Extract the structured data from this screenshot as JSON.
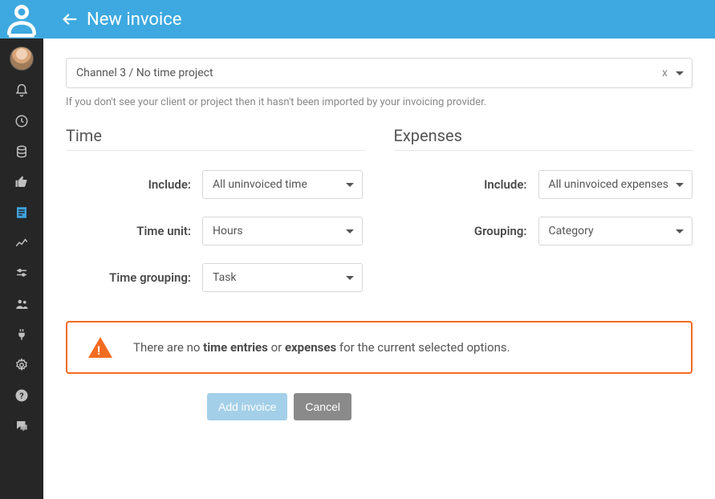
{
  "header": {
    "title": "New invoice"
  },
  "project_select": {
    "value": "Channel 3 / No time project",
    "clear": "x"
  },
  "help_text": "If you don't see your client or project then it hasn't been imported by your invoicing provider.",
  "time_section": {
    "title": "Time",
    "rows": {
      "include": {
        "label": "Include:",
        "value": "All uninvoiced time"
      },
      "time_unit": {
        "label": "Time unit:",
        "value": "Hours"
      },
      "time_grouping": {
        "label": "Time grouping:",
        "value": "Task"
      }
    }
  },
  "expenses_section": {
    "title": "Expenses",
    "rows": {
      "include": {
        "label": "Include:",
        "value": "All uninvoiced expenses"
      },
      "grouping": {
        "label": "Grouping:",
        "value": "Category"
      }
    }
  },
  "alert": {
    "prefix": "There are no ",
    "b1": "time entries",
    "mid": " or ",
    "b2": "expenses",
    "suffix": " for the current selected options."
  },
  "actions": {
    "add": "Add invoice",
    "cancel": "Cancel"
  }
}
